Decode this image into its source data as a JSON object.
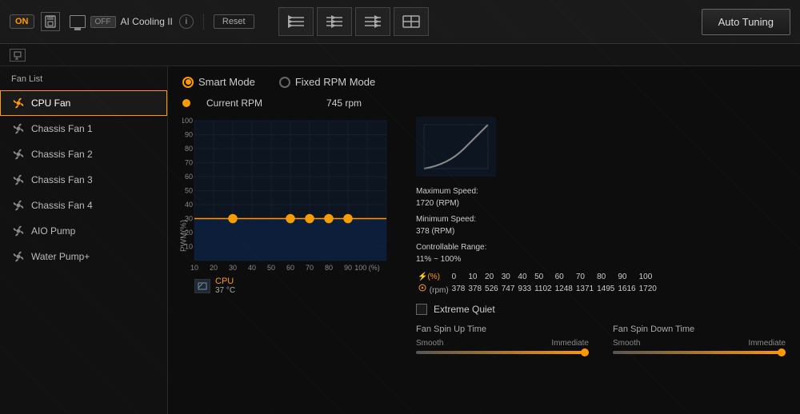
{
  "toolbar": {
    "on_label": "ON",
    "off_label": "OFF",
    "ai_cooling_label": "AI Cooling II",
    "reset_label": "Reset",
    "auto_tuning_label": "Auto Tuning",
    "fan_modes": [
      {
        "id": "mode1",
        "icon": "≋",
        "active": false
      },
      {
        "id": "mode2",
        "icon": "≈",
        "active": false
      },
      {
        "id": "mode3",
        "icon": "≡",
        "active": false
      },
      {
        "id": "mode4",
        "icon": "⊟",
        "active": false
      }
    ]
  },
  "fan_list": {
    "title": "Fan List",
    "items": [
      {
        "id": "cpu-fan",
        "label": "CPU Fan",
        "active": true
      },
      {
        "id": "chassis-fan-1",
        "label": "Chassis Fan 1",
        "active": false
      },
      {
        "id": "chassis-fan-2",
        "label": "Chassis Fan 2",
        "active": false
      },
      {
        "id": "chassis-fan-3",
        "label": "Chassis Fan 3",
        "active": false
      },
      {
        "id": "chassis-fan-4",
        "label": "Chassis Fan 4",
        "active": false
      },
      {
        "id": "aio-pump",
        "label": "AIO Pump",
        "active": false
      },
      {
        "id": "water-pump",
        "label": "Water Pump+",
        "active": false
      }
    ]
  },
  "mode": {
    "smart_label": "Smart Mode",
    "fixed_label": "Fixed RPM Mode",
    "current_rpm_label": "Current RPM",
    "current_rpm_value": "745 rpm"
  },
  "chart": {
    "y_label": "PWM(%)",
    "x_label": "100 (%)",
    "y_ticks": [
      100,
      90,
      80,
      70,
      60,
      50,
      40,
      30,
      20,
      10
    ],
    "x_ticks": [
      10,
      20,
      30,
      40,
      50,
      60,
      70,
      80,
      90,
      100
    ],
    "legend_label": "CPU",
    "legend_temp": "37 °C"
  },
  "fan_info": {
    "max_speed_label": "Maximum Speed:",
    "max_speed_value": "1720 (RPM)",
    "min_speed_label": "Minimum Speed:",
    "min_speed_value": "378 (RPM)",
    "controllable_label": "Controllable Range:",
    "controllable_value": "11% ~ 100%"
  },
  "rpm_table": {
    "percent_icon": "⚡",
    "rpm_icon": "⊙",
    "percent_row": [
      "0",
      "10",
      "20",
      "30",
      "40",
      "50",
      "60",
      "70",
      "80",
      "90",
      "100"
    ],
    "rpm_row": [
      "378",
      "378",
      "526",
      "747",
      "933",
      "1102",
      "1248",
      "1371",
      "1495",
      "1616",
      "1720"
    ]
  },
  "extreme_quiet": {
    "label": "Extreme Quiet"
  },
  "spin_up": {
    "title": "Fan Spin Up Time",
    "smooth_label": "Smooth",
    "immediate_label": "Immediate"
  },
  "spin_down": {
    "title": "Fan Spin Down Time",
    "smooth_label": "Smooth",
    "immediate_label": "Immediate"
  }
}
